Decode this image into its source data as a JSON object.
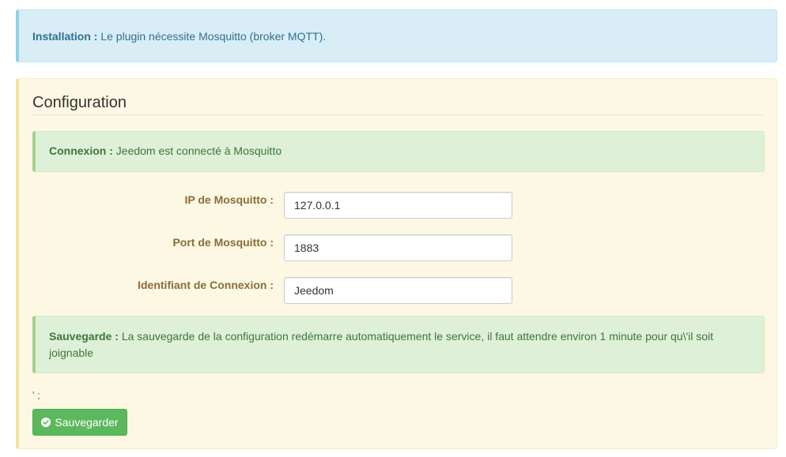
{
  "install_alert": {
    "label": "Installation :",
    "text": "Le plugin nécessite Mosquitto (broker MQTT)."
  },
  "panel": {
    "title": "Configuration",
    "connexion_alert": {
      "label": "Connexion :",
      "text": "Jeedom est connecté à Mosquitto"
    },
    "fields": {
      "ip": {
        "label": "IP de Mosquitto :",
        "value": "127.0.0.1"
      },
      "port": {
        "label": "Port de Mosquitto :",
        "value": "1883"
      },
      "ident": {
        "label": "Identifiant de Connexion :",
        "value": "Jeedom"
      }
    },
    "save_alert": {
      "label": "Sauvegarde :",
      "text": "La sauvegarde de la configuration redémarre automatiquement le service, il faut attendre environ 1 minute pour qu\\'il soit joignable"
    },
    "stray_text": "' ;",
    "save_button": {
      "label": "Sauvegarder",
      "icon": "check-circle-icon"
    }
  },
  "colors": {
    "info_bg": "#d9edf7",
    "info_text": "#31708f",
    "warning_bg": "#fcf8e3",
    "success_bg": "#dff0d8",
    "success_text": "#3c763d",
    "label_text": "#8a6d3b",
    "button_bg": "#5cb85c"
  }
}
